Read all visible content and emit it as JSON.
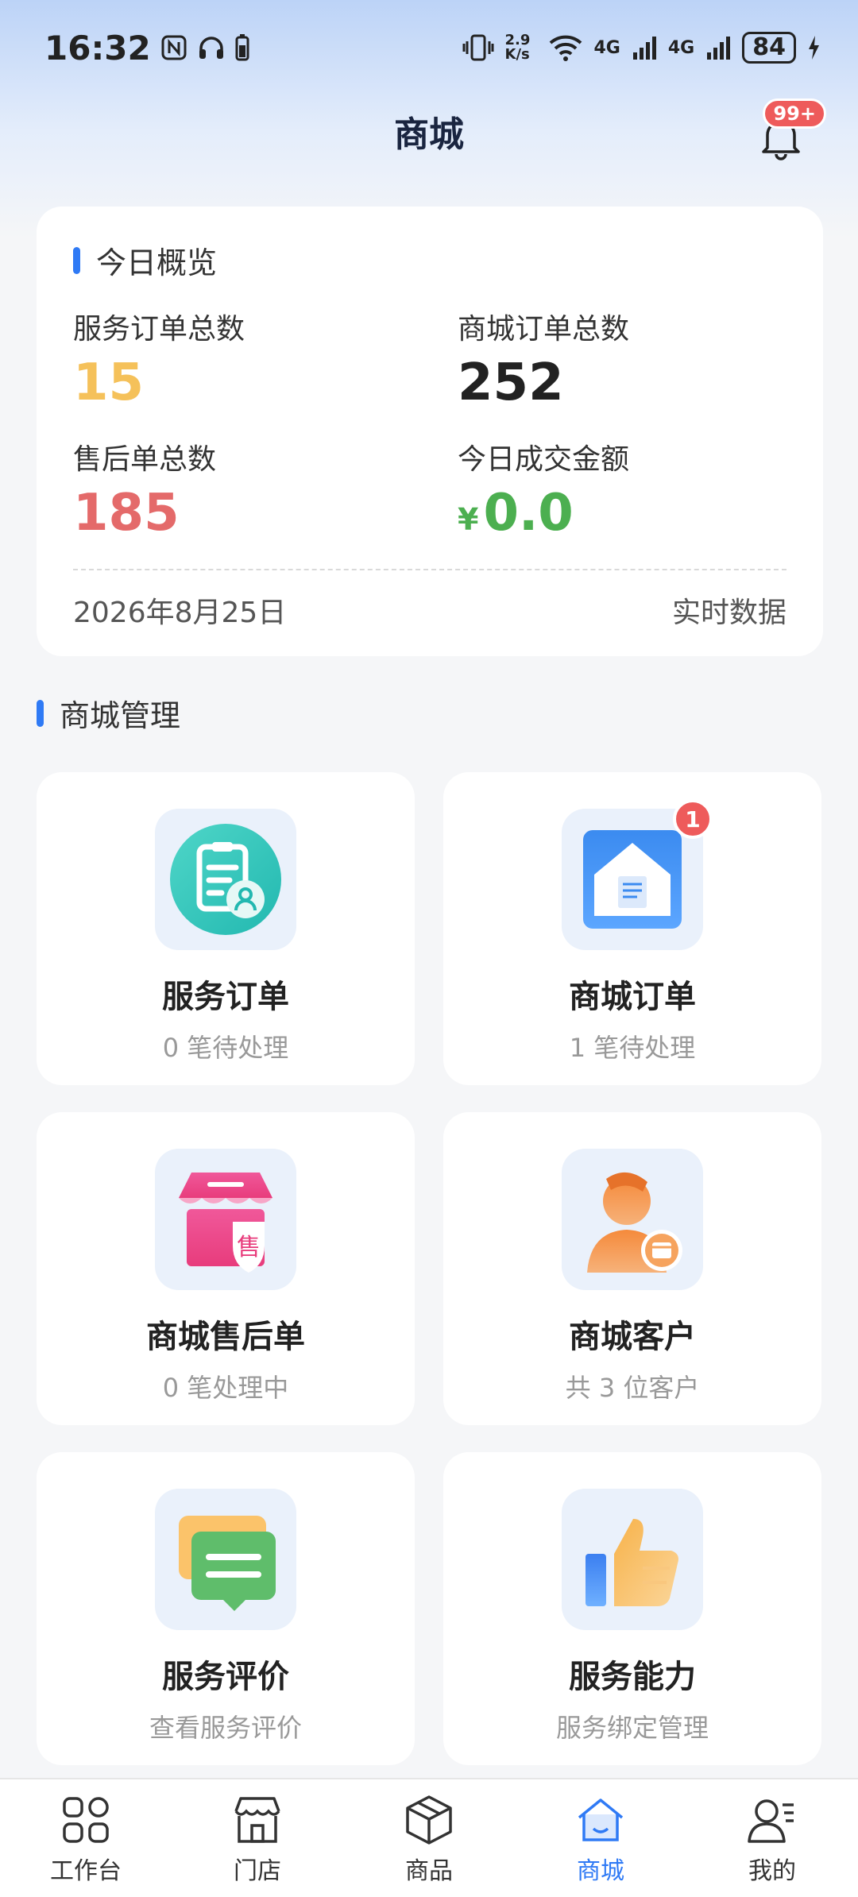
{
  "status_bar": {
    "time": "16:32",
    "net_speed": "2.9 K/s",
    "network1": "4G",
    "network2": "4G",
    "battery": "84"
  },
  "header": {
    "title": "商城",
    "notification_badge": "99+"
  },
  "overview": {
    "title": "今日概览",
    "stats": [
      {
        "label": "服务订单总数",
        "value": "15",
        "color": "#f5c15a"
      },
      {
        "label": "商城订单总数",
        "value": "252",
        "color": "#222222"
      },
      {
        "label": "售后单总数",
        "value": "185",
        "color": "#e46a6a"
      },
      {
        "label": "今日成交金额",
        "currency": "¥",
        "value": "0.0",
        "color": "#4caf50"
      }
    ],
    "date": "2026年8月25日",
    "realtime_label": "实时数据"
  },
  "management": {
    "title": "商城管理",
    "items": [
      {
        "title": "服务订单",
        "subtitle": "0 笔待处理",
        "icon": "service-order-icon"
      },
      {
        "title": "商城订单",
        "subtitle": "1 笔待处理",
        "icon": "mall-order-icon",
        "badge": "1"
      },
      {
        "title": "商城售后单",
        "subtitle": "0 笔处理中",
        "icon": "after-sale-icon"
      },
      {
        "title": "商城客户",
        "subtitle": "共 3 位客户",
        "icon": "customer-icon"
      },
      {
        "title": "服务评价",
        "subtitle": "查看服务评价",
        "icon": "review-icon"
      },
      {
        "title": "服务能力",
        "subtitle": "服务绑定管理",
        "icon": "thumbs-up-icon"
      }
    ]
  },
  "tabbar": {
    "items": [
      {
        "label": "工作台",
        "icon": "workbench-icon"
      },
      {
        "label": "门店",
        "icon": "store-icon"
      },
      {
        "label": "商品",
        "icon": "box-icon"
      },
      {
        "label": "商城",
        "icon": "home-icon",
        "active": true
      },
      {
        "label": "我的",
        "icon": "profile-icon"
      }
    ],
    "active_color": "#2f7af5"
  }
}
